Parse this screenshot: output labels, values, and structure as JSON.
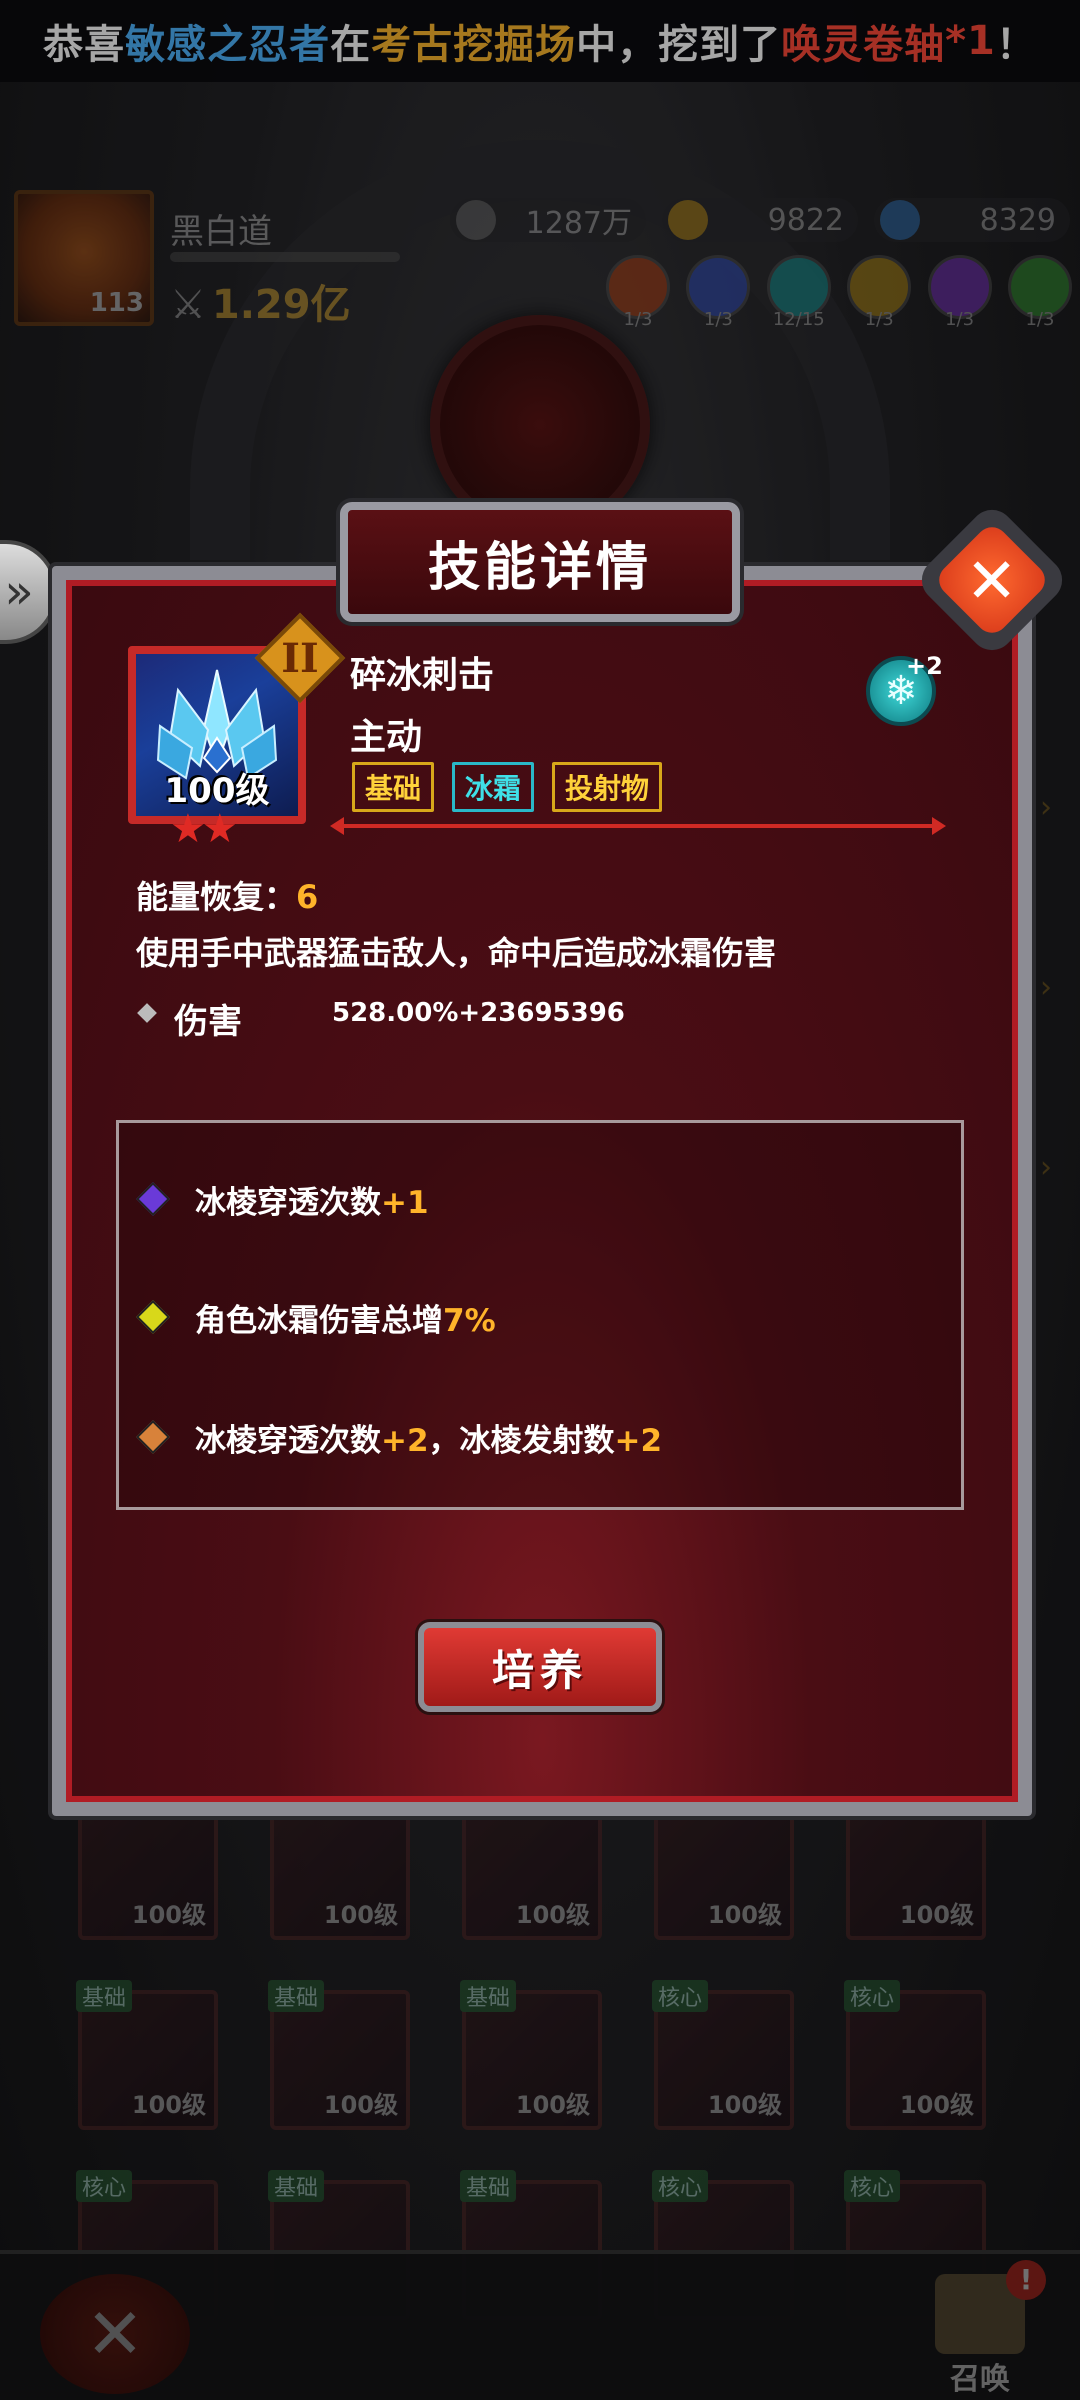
{
  "banner": {
    "part1": "恭喜",
    "player": "敏感之忍者",
    "part2": "在",
    "place": "考古挖掘场",
    "part3": "中，挖到了",
    "item": "唤灵卷轴",
    "count": "*1",
    "end": "！"
  },
  "player": {
    "level": "113",
    "name": "黑白道",
    "power": "1.29亿"
  },
  "currencies": [
    {
      "value": "1287万",
      "color": "#7a7a7a"
    },
    {
      "value": "9822",
      "color": "#d8a21a"
    },
    {
      "value": "8329",
      "color": "#3a8ad8"
    }
  ],
  "elements": [
    {
      "count": "1/3",
      "color": "#c84a1a"
    },
    {
      "count": "1/3",
      "color": "#3a5ad8"
    },
    {
      "count": "12/15",
      "color": "#1aa8a8"
    },
    {
      "count": "1/3",
      "color": "#c89a1a"
    },
    {
      "count": "1/3",
      "color": "#8a3ad8"
    },
    {
      "count": "1/3",
      "color": "#3aa83a"
    }
  ],
  "dialog": {
    "title": "技能详情",
    "skill": {
      "name": "碎冰刺击",
      "type": "主动",
      "level": "100级",
      "tier": "II",
      "stars": "★★",
      "tags": [
        "基础",
        "冰霜",
        "投射物"
      ],
      "element_plus": "+2",
      "element_icon": "snowflake-icon"
    },
    "energy_label": "能量恢复：",
    "energy_value": "6",
    "description": "使用手中武器猛击敌人，命中后造成冰霜伤害",
    "damage_label": "伤害",
    "damage_value": "528.00%+23695396",
    "traits": [
      {
        "color": "#6a3ad8",
        "text_a": "冰棱穿透次数",
        "hl_a": "+1",
        "text_b": "",
        "hl_b": ""
      },
      {
        "color": "#d8d81a",
        "text_a": "角色冰霜伤害总增",
        "hl_a": "7%",
        "text_b": "",
        "hl_b": ""
      },
      {
        "color": "#d8823a",
        "text_a": "冰棱穿透次数",
        "hl_a": "+2",
        "text_b": "，冰棱发射数",
        "hl_b": "+2"
      }
    ],
    "train_button": "培养"
  },
  "grid": {
    "rows": [
      {
        "slots": [
          {
            "tag": "",
            "level": "100级"
          },
          {
            "tag": "",
            "level": "100级"
          },
          {
            "tag": "",
            "level": "100级"
          },
          {
            "tag": "",
            "level": "100级"
          },
          {
            "tag": "",
            "level": "100级"
          }
        ]
      },
      {
        "slots": [
          {
            "tag": "基础",
            "level": "100级"
          },
          {
            "tag": "基础",
            "level": "100级"
          },
          {
            "tag": "基础",
            "level": "100级"
          },
          {
            "tag": "核心",
            "level": "100级"
          },
          {
            "tag": "核心",
            "level": "100级"
          }
        ]
      },
      {
        "slots": [
          {
            "tag": "核心",
            "level": ""
          },
          {
            "tag": "基础",
            "level": ""
          },
          {
            "tag": "基础",
            "level": ""
          },
          {
            "tag": "核心",
            "level": ""
          },
          {
            "tag": "核心",
            "level": ""
          }
        ]
      }
    ]
  },
  "bottom": {
    "summon_label": "召唤",
    "summon_badge": "!"
  }
}
